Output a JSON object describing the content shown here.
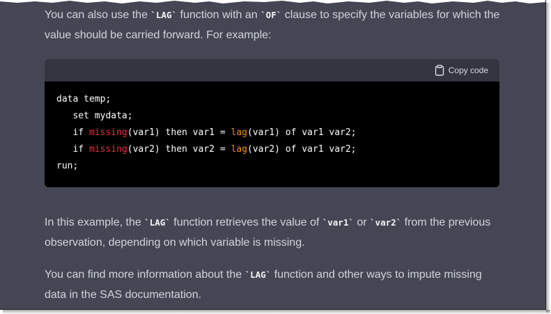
{
  "paragraph1": {
    "text_a": "You can also use the ",
    "code_a": "`LAG`",
    "text_b": " function with an ",
    "code_b": "`OF`",
    "text_c": " clause to specify the variables for which the value should be carried forward. For example:"
  },
  "code_block": {
    "copy_label": "Copy code",
    "lines": [
      {
        "indent": "",
        "parts": [
          {
            "t": "data temp;",
            "c": ""
          }
        ]
      },
      {
        "indent": "   ",
        "parts": [
          {
            "t": "set mydata;",
            "c": ""
          }
        ]
      },
      {
        "indent": "   ",
        "parts": [
          {
            "t": "if ",
            "c": ""
          },
          {
            "t": "missing",
            "c": "kw-fn"
          },
          {
            "t": "(var1) then var1 = ",
            "c": ""
          },
          {
            "t": "lag",
            "c": "lag-fn"
          },
          {
            "t": "(var1) of var1 var2;",
            "c": ""
          }
        ]
      },
      {
        "indent": "   ",
        "parts": [
          {
            "t": "if ",
            "c": ""
          },
          {
            "t": "missing",
            "c": "kw-fn"
          },
          {
            "t": "(var2) then var2 = ",
            "c": ""
          },
          {
            "t": "lag",
            "c": "lag-fn"
          },
          {
            "t": "(var2) of var1 var2;",
            "c": ""
          }
        ]
      },
      {
        "indent": "",
        "parts": [
          {
            "t": "run;",
            "c": ""
          }
        ]
      }
    ]
  },
  "paragraph2": {
    "text_a": "In this example, the ",
    "code_a": "`LAG`",
    "text_b": " function retrieves the value of ",
    "code_b": "`var1`",
    "text_c": " or ",
    "code_c": "`var2`",
    "text_d": " from the previous observation, depending on which variable is missing."
  },
  "paragraph3": {
    "text_a": "You can find more information about the ",
    "code_a": "`LAG`",
    "text_b": " function and other ways to impute missing data in the SAS documentation."
  },
  "colors": {
    "background": "#444654",
    "code_background": "#000000",
    "code_header": "#343541",
    "missing_fn": "#f22c3d",
    "lag_fn": "#e9950c"
  },
  "icons": {
    "copy": "clipboard-icon"
  }
}
